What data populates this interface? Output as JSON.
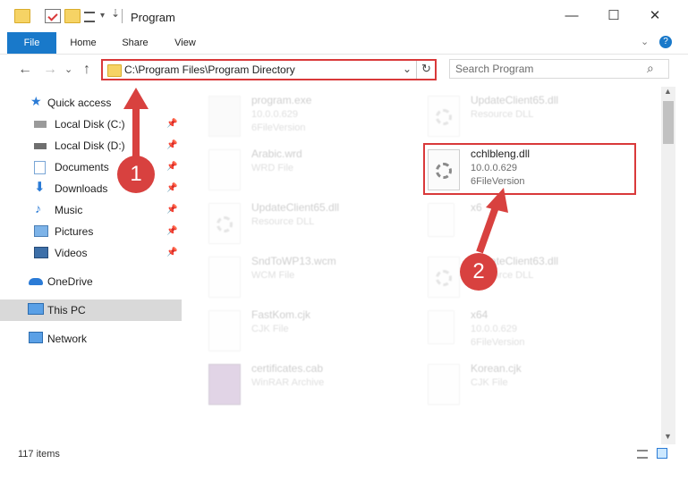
{
  "window": {
    "title": "Program",
    "minimize_label": "—",
    "maximize_label": "☐",
    "close_label": "✕"
  },
  "ribbon": {
    "tabs": [
      "File",
      "Home",
      "Share",
      "View"
    ]
  },
  "navbar": {
    "back_icon": "←",
    "forward_icon": "→",
    "dropdown_icon": "⌄",
    "up_icon": "↑",
    "address": "C:\\Program Files\\Program Directory",
    "refresh_icon": "↻",
    "search_placeholder": "Search Program",
    "search_icon": "⌕"
  },
  "sidebar": {
    "items": [
      {
        "label": "Quick access",
        "icon": "star-icon",
        "pinned": false
      },
      {
        "label": "Local Disk (C:)",
        "icon": "drive-icon",
        "pinned": true
      },
      {
        "label": "Local Disk (D:)",
        "icon": "drive-icon",
        "pinned": true
      },
      {
        "label": "Documents",
        "icon": "documents-icon",
        "pinned": true
      },
      {
        "label": "Downloads",
        "icon": "download-icon",
        "pinned": true
      },
      {
        "label": "Music",
        "icon": "music-icon",
        "pinned": true
      },
      {
        "label": "Pictures",
        "icon": "pictures-icon",
        "pinned": true
      },
      {
        "label": "Videos",
        "icon": "videos-icon",
        "pinned": true
      },
      {
        "label": "OneDrive",
        "icon": "cloud-icon",
        "pinned": false
      },
      {
        "label": "This PC",
        "icon": "computer-icon",
        "pinned": false,
        "selected": true
      },
      {
        "label": "Network",
        "icon": "network-icon",
        "pinned": false
      }
    ]
  },
  "files": [
    {
      "name": "program.exe",
      "line2": "10.0.0.629",
      "line3": "6FileVersion",
      "kind": "exe"
    },
    {
      "name": "UpdateClient65.dll",
      "line2": "Resource DLL",
      "line3": "",
      "kind": "dll"
    },
    {
      "name": "Arabic.wrd",
      "line2": "WRD File",
      "line3": "",
      "kind": "doc"
    },
    {
      "name": "cchlbleng.dll",
      "line2": "10.0.0.629",
      "line3": "6FileVersion",
      "kind": "dll",
      "highlighted": true
    },
    {
      "name": "UpdateClient65.dll",
      "line2": "Resource DLL",
      "line3": "",
      "kind": "dll"
    },
    {
      "name": "x6",
      "line2": "",
      "line3": "",
      "kind": "folder"
    },
    {
      "name": "SndToWP13.wcm",
      "line2": "WCM File",
      "line3": "",
      "kind": "doc"
    },
    {
      "name": "UpdateClient63.dll",
      "line2": "Resource DLL",
      "line3": "",
      "kind": "dll"
    },
    {
      "name": "FastKom.cjk",
      "line2": "CJK File",
      "line3": "",
      "kind": "doc"
    },
    {
      "name": "x64",
      "line2": "10.0.0.629",
      "line3": "6FileVersion",
      "kind": "folder"
    },
    {
      "name": "certificates.cab",
      "line2": "WinRAR Archive",
      "line3": "",
      "kind": "archive"
    },
    {
      "name": "Korean.cjk",
      "line2": "CJK File",
      "line3": "",
      "kind": "doc"
    }
  ],
  "status": {
    "count": "117 items"
  },
  "annotations": {
    "step1": "1",
    "step2": "2"
  },
  "colors": {
    "accent": "#1979ca",
    "highlight_red": "#d9393a",
    "callout_red": "#d8413f",
    "selected_row": "#cce8ff"
  }
}
